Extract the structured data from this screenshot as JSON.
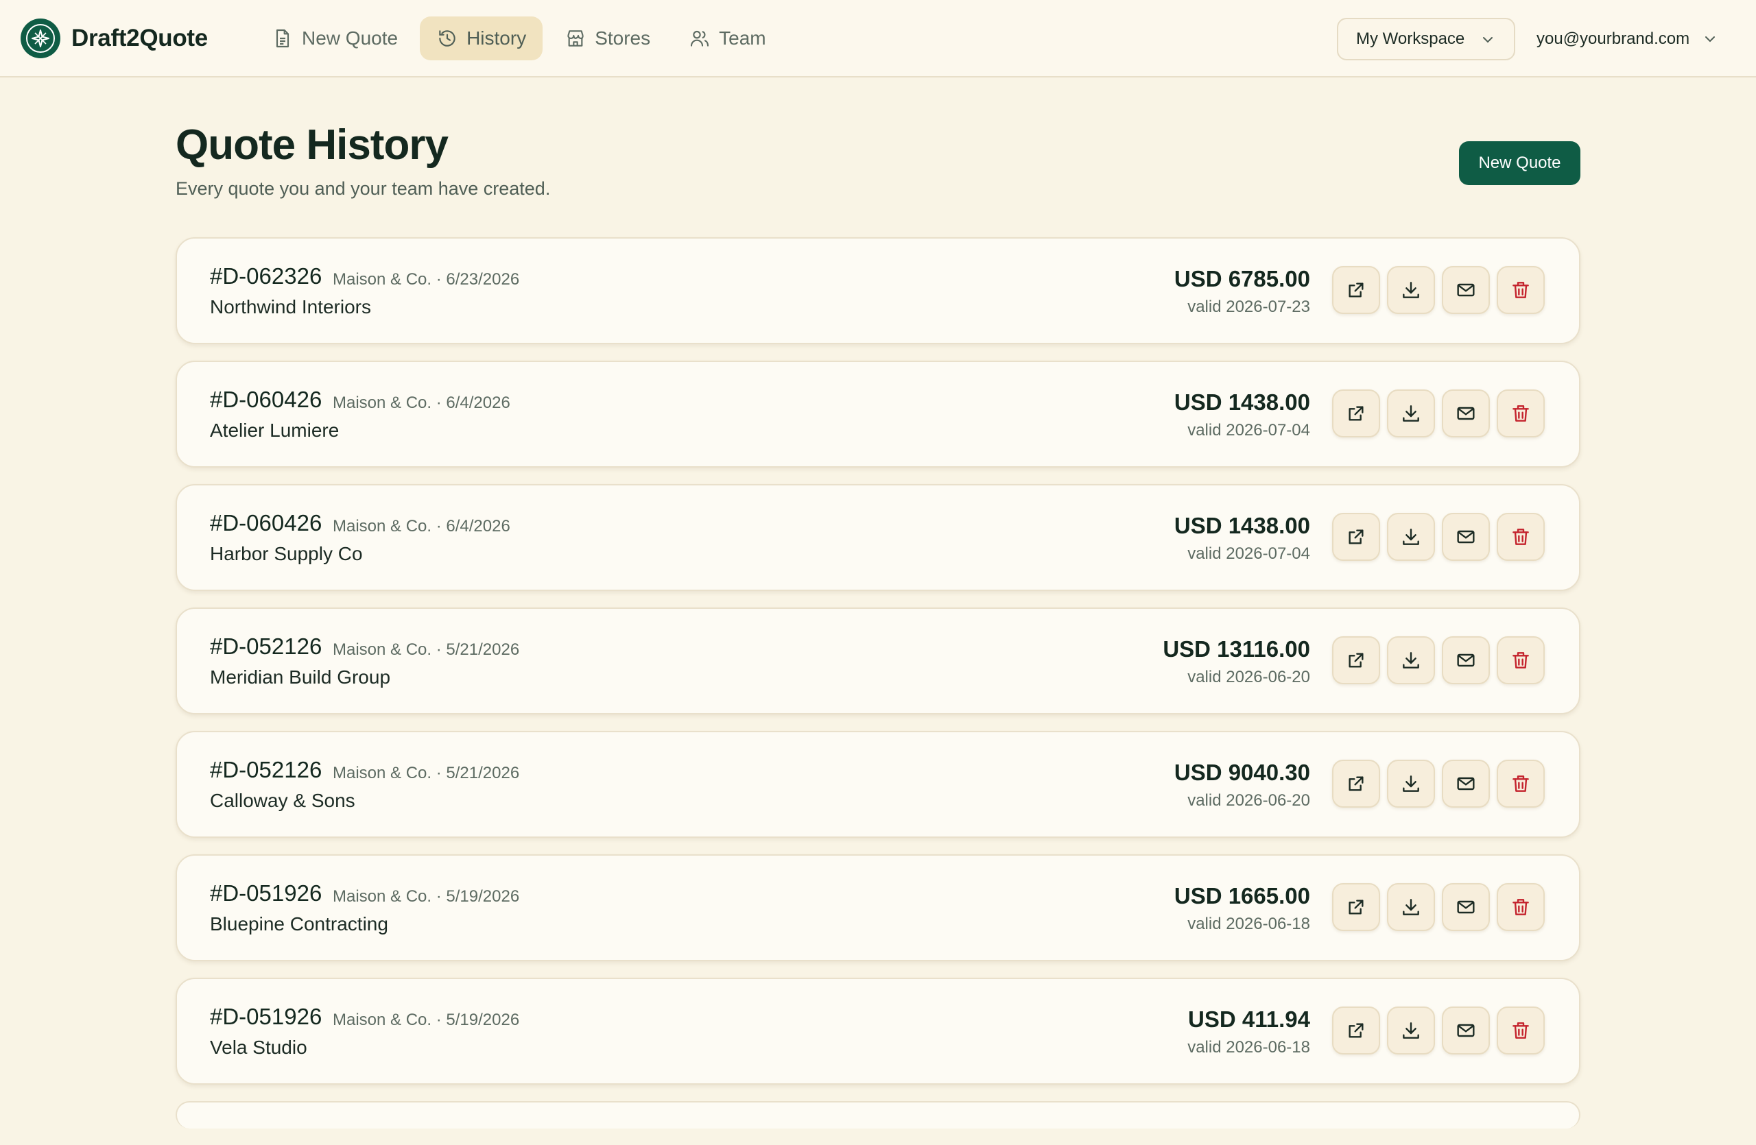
{
  "app": {
    "name": "Draft2Quote",
    "colors": {
      "brand": "#0f5c45",
      "background": "#f9f4e5",
      "danger": "#c4232d"
    }
  },
  "nav": {
    "items": [
      {
        "label": "New Quote",
        "icon": "document-icon",
        "active": false
      },
      {
        "label": "History",
        "icon": "history-icon",
        "active": true
      },
      {
        "label": "Stores",
        "icon": "store-icon",
        "active": false
      },
      {
        "label": "Team",
        "icon": "users-icon",
        "active": false
      }
    ]
  },
  "workspace": {
    "label": "My Workspace"
  },
  "account": {
    "email": "you@yourbrand.com"
  },
  "page": {
    "title": "Quote History",
    "subtitle": "Every quote you and your team have created.",
    "new_quote_label": "New Quote"
  },
  "quotes": [
    {
      "id": "#D-062326",
      "store": "Maison & Co.",
      "date": "6/23/2026",
      "client": "Northwind Interiors",
      "amount": "USD 6785.00",
      "valid": "valid 2026-07-23"
    },
    {
      "id": "#D-060426",
      "store": "Maison & Co.",
      "date": "6/4/2026",
      "client": "Atelier Lumiere",
      "amount": "USD 1438.00",
      "valid": "valid 2026-07-04"
    },
    {
      "id": "#D-060426",
      "store": "Maison & Co.",
      "date": "6/4/2026",
      "client": "Harbor Supply Co",
      "amount": "USD 1438.00",
      "valid": "valid 2026-07-04"
    },
    {
      "id": "#D-052126",
      "store": "Maison & Co.",
      "date": "5/21/2026",
      "client": "Meridian Build Group",
      "amount": "USD 13116.00",
      "valid": "valid 2026-06-20"
    },
    {
      "id": "#D-052126",
      "store": "Maison & Co.",
      "date": "5/21/2026",
      "client": "Calloway & Sons",
      "amount": "USD 9040.30",
      "valid": "valid 2026-06-20"
    },
    {
      "id": "#D-051926",
      "store": "Maison & Co.",
      "date": "5/19/2026",
      "client": "Bluepine Contracting",
      "amount": "USD 1665.00",
      "valid": "valid 2026-06-18"
    },
    {
      "id": "#D-051926",
      "store": "Maison & Co.",
      "date": "5/19/2026",
      "client": "Vela Studio",
      "amount": "USD 411.94",
      "valid": "valid 2026-06-18"
    }
  ],
  "row_actions": [
    "open-external-icon",
    "download-icon",
    "mail-icon",
    "trash-icon"
  ]
}
